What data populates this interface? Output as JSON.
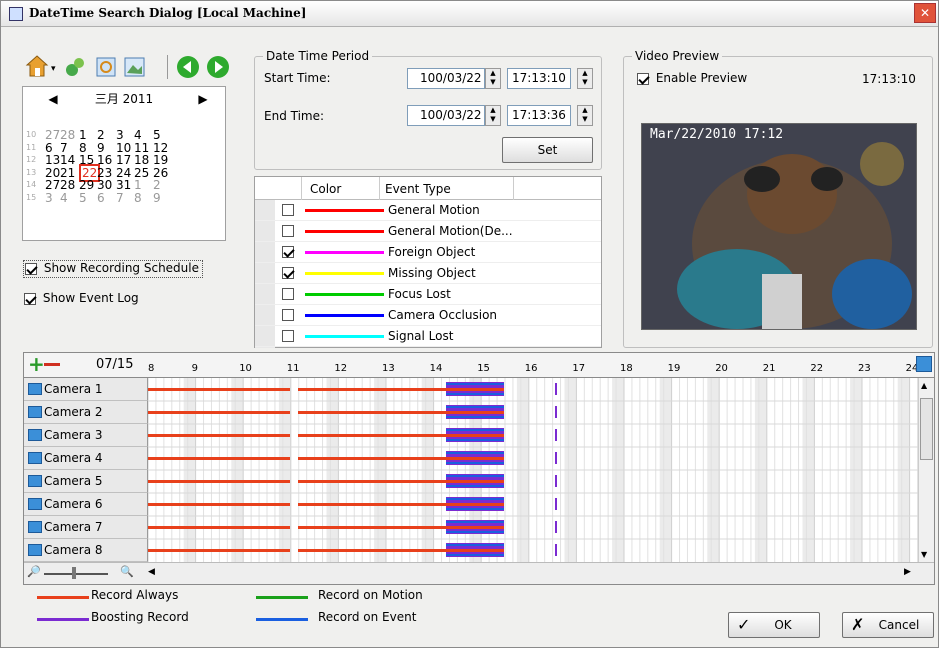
{
  "window": {
    "title": "DateTime Search Dialog  [Local Machine]",
    "close": "✕"
  },
  "calendar": {
    "month": "三月 2011",
    "rows": [
      {
        "wk": "10",
        "days": [
          "27",
          "28",
          "1",
          "2",
          "3",
          "4",
          "5"
        ]
      },
      {
        "wk": "11",
        "days": [
          "6",
          "7",
          "8",
          "9",
          "10",
          "11",
          "12"
        ]
      },
      {
        "wk": "12",
        "days": [
          "13",
          "14",
          "15",
          "16",
          "17",
          "18",
          "19"
        ]
      },
      {
        "wk": "13",
        "days": [
          "20",
          "21",
          "22",
          "23",
          "24",
          "25",
          "26"
        ]
      },
      {
        "wk": "14",
        "days": [
          "27",
          "28",
          "29",
          "30",
          "31",
          "1",
          "2"
        ]
      },
      {
        "wk": "15",
        "days": [
          "3",
          "4",
          "5",
          "6",
          "7",
          "8",
          "9"
        ]
      }
    ],
    "selected": "22"
  },
  "options": {
    "show_schedule": "Show Recording Schedule",
    "show_event_log": "Show Event Log"
  },
  "period": {
    "legend": "Date Time Period",
    "start_label": "Start Time:",
    "start_date": "100/03/22",
    "start_time": "17:13:10",
    "end_label": "End Time:",
    "end_date": "100/03/22",
    "end_time": "17:13:36",
    "set": "Set"
  },
  "events": {
    "col_color": "Color",
    "col_type": "Event Type",
    "rows": [
      {
        "label": "General Motion",
        "color": "#ff0000",
        "checked": false
      },
      {
        "label": "General Motion(De...",
        "color": "#ff0000",
        "checked": false
      },
      {
        "label": "Foreign Object",
        "color": "#ff00ff",
        "checked": true
      },
      {
        "label": "Missing Object",
        "color": "#ffff00",
        "checked": true
      },
      {
        "label": "Focus Lost",
        "color": "#00cc00",
        "checked": false
      },
      {
        "label": "Camera Occlusion",
        "color": "#0000ff",
        "checked": false
      },
      {
        "label": "Signal Lost",
        "color": "#00ffff",
        "checked": false
      }
    ]
  },
  "preview": {
    "legend": "Video Preview",
    "enable": "Enable Preview",
    "time": "17:13:10",
    "osd": "Mar/22/2010 17:12"
  },
  "timeline": {
    "date": "07/15",
    "hours": [
      "8",
      "9",
      "10",
      "11",
      "12",
      "13",
      "14",
      "15",
      "16",
      "17",
      "18",
      "19",
      "20",
      "21",
      "22",
      "23",
      "24"
    ],
    "cameras": [
      "Camera 1",
      "Camera 2",
      "Camera 3",
      "Camera 4",
      "Camera 5",
      "Camera 6",
      "Camera 7",
      "Camera 8"
    ]
  },
  "legend": {
    "always": "Record Always",
    "boosting": "Boosting Record",
    "motion": "Record on Motion",
    "event": "Record on Event"
  },
  "colors": {
    "always": "#e8401b",
    "boosting": "#7b2bd1",
    "motion": "#1aa11a",
    "event": "#1a5fe0"
  },
  "buttons": {
    "ok": "OK",
    "cancel": "Cancel"
  }
}
